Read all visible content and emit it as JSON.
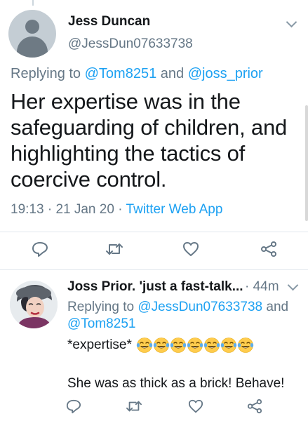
{
  "tweet1": {
    "author_name": "Jess Duncan",
    "author_handle": "@JessDun07633738",
    "replying_prefix": "Replying to",
    "replying_user1": "@Tom8251",
    "replying_and": "and",
    "replying_user2": "@joss_prior",
    "text": "Her expertise was in the safeguarding of children, and highlighting the tactics of coercive control.",
    "time": "19:13",
    "date": "21 Jan 20",
    "sep": "·",
    "source": "Twitter Web App",
    "avatar_icon": "default-profile-icon",
    "menu_icon": "chevron-down-icon"
  },
  "tweet2": {
    "author_name": "Joss Prior. 'just a fast-talk...",
    "time_sep": "·",
    "time": "44m",
    "replying_prefix": "Replying to",
    "replying_user1": "@JessDun07633738",
    "replying_and": "and",
    "replying_user2": "@Tom8251",
    "line1": "*expertise*",
    "emoji_name": "face-with-tears-of-joy",
    "emoji_count": 7,
    "line2": "She was as thick as a brick! Behave!",
    "menu_icon": "chevron-down-icon"
  },
  "actions": [
    "reply-icon",
    "retweet-icon",
    "like-icon",
    "share-icon"
  ],
  "colors": {
    "accent": "#1da1f2",
    "secondary_text": "#657786",
    "primary_text": "#14171a",
    "divider": "#e1e8ed",
    "icon": "#657786"
  }
}
